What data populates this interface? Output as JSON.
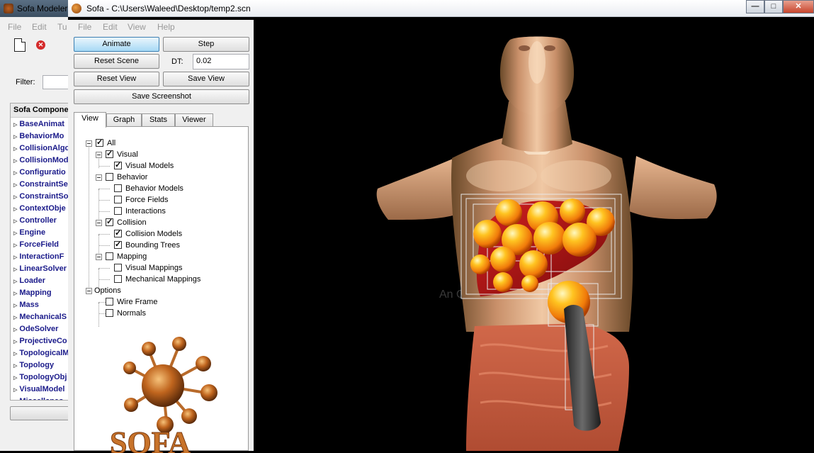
{
  "modeler": {
    "title": "Sofa Modeler",
    "menu": [
      "File",
      "Edit",
      "Tu"
    ],
    "filter_label": "Filter:",
    "tree_header": "Sofa Compone",
    "tree_items": [
      "BaseAnimat",
      "BehaviorMo",
      "CollisionAlgo",
      "CollisionMod",
      "Configuratio",
      "ConstraintSe",
      "ConstraintSo",
      "ContextObje",
      "Controller",
      "Engine",
      "ForceField",
      "InteractionF",
      "LinearSolver",
      "Loader",
      "Mapping",
      "Mass",
      "MechanicalS",
      "OdeSolver",
      "ProjectiveCo",
      "TopologicalM",
      "Topology",
      "TopologyObj",
      "VisualModel",
      "Miscellaneo"
    ]
  },
  "window": {
    "title": "Sofa - C:\\Users\\Waleed\\Desktop/temp2.scn",
    "menu": [
      "File",
      "Edit",
      "View",
      "Help"
    ],
    "minimize": "—",
    "maximize": "□",
    "close": "✕"
  },
  "controls": {
    "animate": "Animate",
    "step": "Step",
    "reset_scene": "Reset Scene",
    "dt_label": "DT:",
    "dt_value": "0.02",
    "reset_view": "Reset View",
    "save_view": "Save View",
    "save_screenshot": "Save Screenshot"
  },
  "tabs": [
    "View",
    "Graph",
    "Stats",
    "Viewer"
  ],
  "view_tree": {
    "all": {
      "label": "All",
      "checked": true
    },
    "visual": {
      "label": "Visual",
      "checked": true
    },
    "visual_models": {
      "label": "Visual Models",
      "checked": true
    },
    "behavior": {
      "label": "Behavior",
      "checked": false
    },
    "behavior_models": {
      "label": "Behavior Models",
      "checked": false
    },
    "force_fields": {
      "label": "Force Fields",
      "checked": false
    },
    "interactions": {
      "label": "Interactions",
      "checked": false
    },
    "collision": {
      "label": "Collision",
      "checked": true
    },
    "collision_models": {
      "label": "Collision Models",
      "checked": true
    },
    "bounding_trees": {
      "label": "Bounding Trees",
      "checked": true
    },
    "mapping": {
      "label": "Mapping",
      "checked": false
    },
    "visual_mappings": {
      "label": "Visual Mappings",
      "checked": false
    },
    "mechanical_mappings": {
      "label": "Mechanical Mappings",
      "checked": false
    },
    "options": {
      "label": "Options"
    },
    "wire_frame": {
      "label": "Wire Frame",
      "checked": false
    },
    "normals": {
      "label": "Normals",
      "checked": false
    }
  },
  "logo_text": "SOFA",
  "watermark": "An Op                 on"
}
